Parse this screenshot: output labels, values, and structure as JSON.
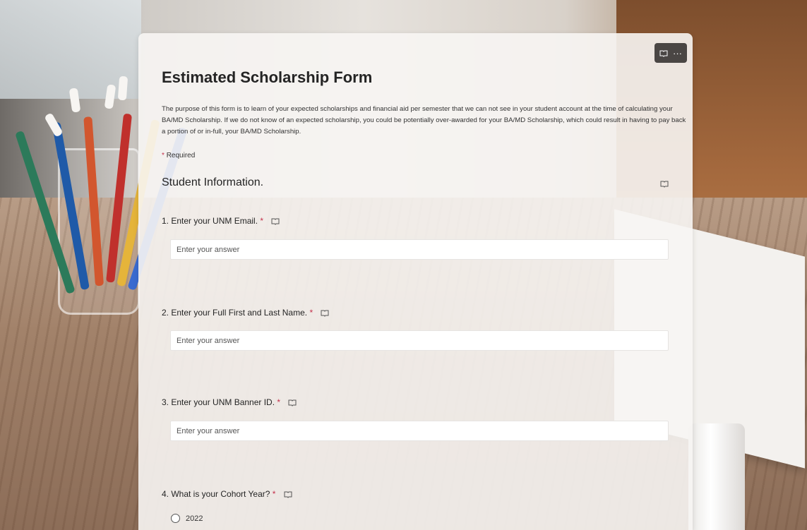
{
  "form": {
    "title": "Estimated Scholarship Form",
    "description": "The purpose of this form is to learn of your expected scholarships and financial aid per semester that we can not see in your student account at the time of calculating your BA/MD Scholarship. If we do not know of an expected scholarship, you could be potentially over-awarded for your BA/MD Scholarship, which could result in having to pay back a portion of or in-full, your BA/MD Scholarship.",
    "required_asterisk": "*",
    "required_label": "Required",
    "toolbar": {
      "reader_icon": "immersive-reader-icon",
      "more_label": "···"
    }
  },
  "section": {
    "title": "Student Information."
  },
  "questions": [
    {
      "label": "1. Enter your UNM Email.",
      "asterisk": "*",
      "placeholder": "Enter your answer",
      "value": ""
    },
    {
      "label": "2. Enter your Full First and Last Name.",
      "asterisk": "*",
      "placeholder": "Enter your answer",
      "value": ""
    },
    {
      "label": "3. Enter your UNM Banner ID.",
      "asterisk": "*",
      "placeholder": "Enter your answer",
      "value": ""
    },
    {
      "label": "4. What is your Cohort Year?",
      "asterisk": "*",
      "options": [
        "2022"
      ]
    }
  ],
  "colors": {
    "required": "#c4314b",
    "card": "#f7f5f3",
    "toolbar": "#4a4644"
  }
}
